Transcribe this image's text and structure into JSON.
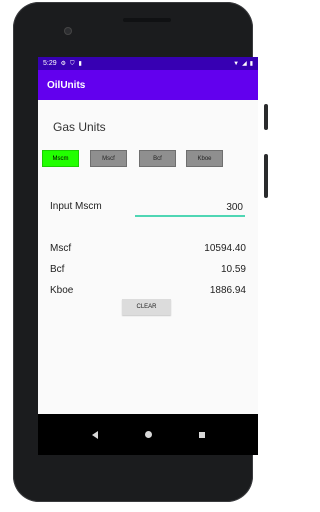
{
  "status_bar": {
    "time": "5:29",
    "left_icons": [
      "settings-icon",
      "shield-icon",
      "battery-saver-icon"
    ],
    "right_icons": [
      "wifi-icon",
      "signal-icon",
      "battery-icon"
    ]
  },
  "app": {
    "title": "OilUnits"
  },
  "main": {
    "section_title": "Gas Units",
    "unit_buttons": [
      {
        "label": "Mscm",
        "active": true
      },
      {
        "label": "Mscf",
        "active": false
      },
      {
        "label": "Bcf",
        "active": false
      },
      {
        "label": "Kboe",
        "active": false
      }
    ],
    "input_label": "Input Mscm",
    "input_value": "300",
    "results": [
      {
        "label": "Mscf",
        "value": "10594.40"
      },
      {
        "label": "Bcf",
        "value": "10.59"
      },
      {
        "label": "Kboe",
        "value": "1886.94"
      }
    ],
    "clear_label": "CLEAR"
  },
  "colors": {
    "status_bar": "#3700b3",
    "app_bar": "#6200ee",
    "active_button": "#22ff00",
    "inactive_button": "#8f8f8f",
    "input_underline": "#4fd6b4"
  },
  "nav_bar": {
    "icons": [
      "back-icon",
      "home-icon",
      "recents-icon"
    ]
  }
}
